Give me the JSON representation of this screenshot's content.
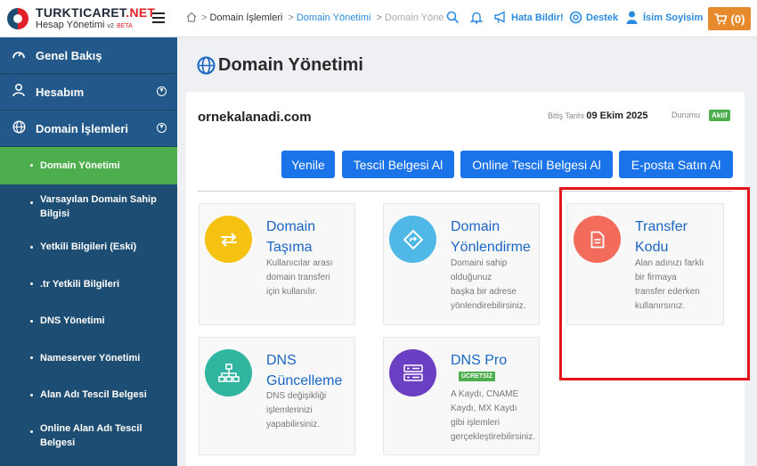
{
  "brand": {
    "title_main": "TURKTICARET",
    "title_accent": ".NET",
    "subtitle": "Hesap Yönetimi",
    "version": "v2",
    "beta": "BETA"
  },
  "sidebar": {
    "top_items": [
      {
        "label": "Genel Bakış",
        "icon": "dashboard-icon"
      },
      {
        "label": "Hesabım",
        "icon": "user-icon"
      },
      {
        "label": "Domain İşlemleri",
        "icon": "globe-icon"
      }
    ],
    "sub_items": [
      {
        "label": "Domain Yönetimi",
        "active": true
      },
      {
        "label": "Varsayılan Domain Sahip Bilgisi"
      },
      {
        "label": "Yetkili Bilgileri (Eski)"
      },
      {
        "label": ".tr Yetkili Bilgileri"
      },
      {
        "label": "DNS Yönetimi"
      },
      {
        "label": "Nameserver Yönetimi"
      },
      {
        "label": "Alan Adı Tescil Belgesi"
      },
      {
        "label": "Online Alan Adı Tescil Belgesi"
      }
    ]
  },
  "header": {
    "breadcrumb": [
      "Domain İşlemleri",
      "Domain Yönetimi",
      "Domain Yönetimi"
    ],
    "report_bug": "Hata Bildir!",
    "support": "Destek",
    "user_name": "İsim Soyisim",
    "cart_count": "(0)"
  },
  "main": {
    "title": "Domain Yönetimi",
    "domain": "ornekalanadi.com",
    "expiry_label": "Bitiş Tarihi",
    "expiry_value": "09 Ekim 2025",
    "status_label": "Durumu",
    "status_value": "Aktif",
    "buttons": [
      "Yenile",
      "Tescil Belgesi Al",
      "Online Tescil Belgesi Al",
      "E-posta Satın Al"
    ],
    "cards": [
      {
        "title_lines": [
          "Domain",
          "Taşıma"
        ],
        "desc_lines": [
          "Kullanıcılar arası",
          "domain transferi",
          "için kullanılır."
        ],
        "icon": "transfer-arrows-icon",
        "color": "#f5c211"
      },
      {
        "title_lines": [
          "Domain",
          "Yönlendirme"
        ],
        "desc_lines": [
          "Domaini sahip",
          "olduğunuz",
          "başka bir adrese",
          "yönlendirebilirsiniz."
        ],
        "icon": "redirect-icon",
        "color": "#4fb8e6"
      },
      {
        "title_lines": [
          "Transfer",
          "Kodu"
        ],
        "desc_lines": [
          "Alan adınızı farklı",
          "bir firmaya",
          "transfer ederken",
          "kullanırsınız."
        ],
        "icon": "document-icon",
        "color": "#f26b5b"
      },
      {
        "title_lines": [
          "DNS",
          "Güncelleme"
        ],
        "desc_lines": [
          "DNS değişikliği",
          "işlemlerinizi",
          "yapabilirsiniz."
        ],
        "icon": "network-icon",
        "color": "#2fb5a0"
      },
      {
        "title_lines": [
          "DNS Pro"
        ],
        "badge": "ÜCRETSİZ",
        "desc_lines": [
          "A Kaydı, CNAME",
          "Kaydı, MX Kaydı",
          "gibi işlemleri",
          "gerçekleştirebilirsiniz."
        ],
        "icon": "dns-server-icon",
        "color": "#6a3fc1"
      }
    ]
  },
  "colors": {
    "sidebar": "#1e4d73",
    "active": "#4cae4c",
    "primary": "#1a73e8",
    "highlight": "#e4141b",
    "cart": "#e78a2e"
  }
}
